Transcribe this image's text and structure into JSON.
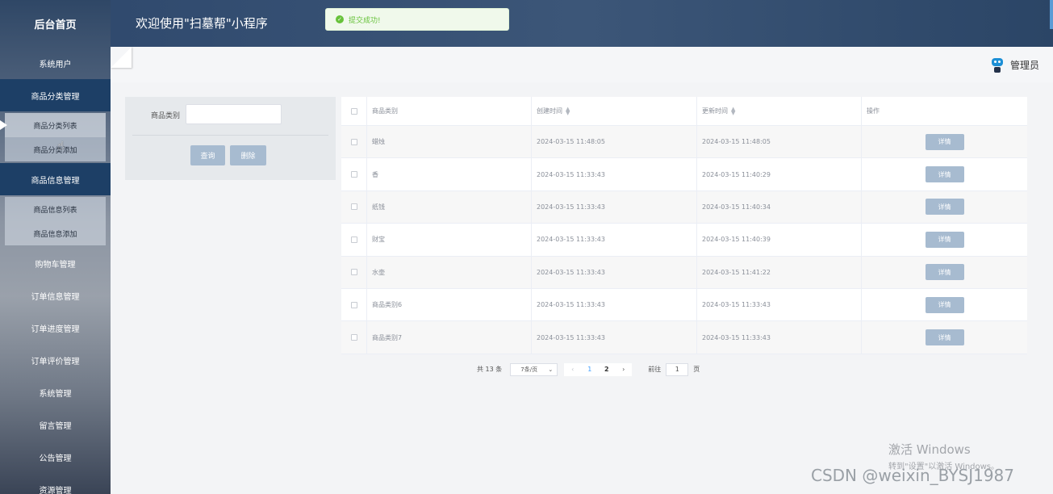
{
  "sidebar": {
    "title": "后台首页",
    "items": [
      {
        "label": "系统用户"
      },
      {
        "label": "商品分类管理"
      },
      {
        "label": "商品信息管理"
      },
      {
        "label": "购物车管理"
      },
      {
        "label": "订单信息管理"
      },
      {
        "label": "订单进度管理"
      },
      {
        "label": "订单评价管理"
      },
      {
        "label": "系统管理"
      },
      {
        "label": "留言管理"
      },
      {
        "label": "公告管理"
      },
      {
        "label": "资源管理"
      }
    ],
    "category_sub": [
      "商品分类列表",
      "商品分类添加"
    ],
    "goods_sub": [
      "商品信息列表",
      "商品信息添加"
    ]
  },
  "header": {
    "title": "欢迎使用\"扫墓帮\"小程序",
    "toast": "提交成功!"
  },
  "topbar": {
    "user": "管理员"
  },
  "search": {
    "label": "商品类别",
    "value": "",
    "query_button": "查询",
    "delete_button": "删除"
  },
  "table": {
    "columns": [
      "商品类别",
      "创建时间",
      "更新时间",
      "操作"
    ],
    "detail_label": "详情",
    "rows": [
      {
        "name": "蜡烛",
        "created": "2024-03-15 11:48:05",
        "updated": "2024-03-15 11:48:05"
      },
      {
        "name": "香",
        "created": "2024-03-15 11:33:43",
        "updated": "2024-03-15 11:40:29"
      },
      {
        "name": "纸钱",
        "created": "2024-03-15 11:33:43",
        "updated": "2024-03-15 11:40:34"
      },
      {
        "name": "财宝",
        "created": "2024-03-15 11:33:43",
        "updated": "2024-03-15 11:40:39"
      },
      {
        "name": "水壶",
        "created": "2024-03-15 11:33:43",
        "updated": "2024-03-15 11:41:22"
      },
      {
        "name": "商品类别6",
        "created": "2024-03-15 11:33:43",
        "updated": "2024-03-15 11:33:43"
      },
      {
        "name": "商品类别7",
        "created": "2024-03-15 11:33:43",
        "updated": "2024-03-15 11:33:43"
      }
    ]
  },
  "pagination": {
    "total": "共 13 条",
    "page_size": "7条/页",
    "pages": [
      "1",
      "2"
    ],
    "goto_label": "前往",
    "goto_value": "1",
    "page_unit": "页"
  },
  "watermark": {
    "line1": "激活 Windows",
    "line2": "转到\"设置\"以激活 Windows。",
    "csdn": "CSDN @weixin_BYSJ1987"
  }
}
